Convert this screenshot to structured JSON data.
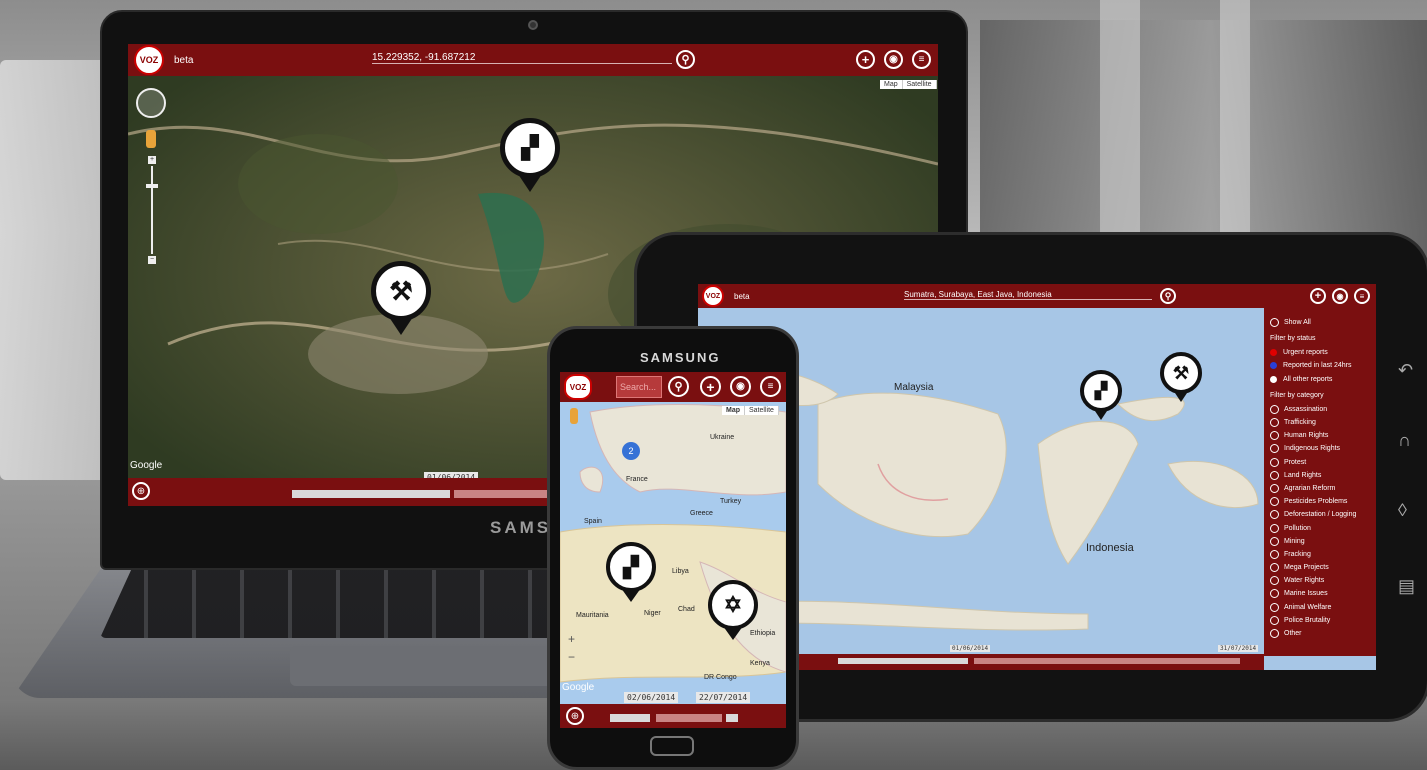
{
  "laptop": {
    "brand": "SAMSUNG",
    "app": {
      "beta_label": "beta",
      "search_value": "15.229352, -91.687212",
      "map_type": [
        "Map",
        "Satellite"
      ],
      "date_start": "01/06/2014",
      "attribution": "Google",
      "pins": [
        {
          "category": "deforestation",
          "icon": "stump-icon"
        },
        {
          "category": "mining",
          "icon": "crossed-hammers-icon"
        }
      ]
    }
  },
  "tablet": {
    "app": {
      "beta_label": "beta",
      "search_value": "Sumatra, Surabaya, East Java, Indonesia",
      "date_start": "01/06/2014",
      "date_end": "31/07/2014",
      "map_labels": [
        "Malaysia",
        "Indonesia"
      ],
      "panel": {
        "show_all": "Show All",
        "filter_status_title": "Filter by status",
        "status": [
          {
            "label": "Urgent reports",
            "color": "#e00000"
          },
          {
            "label": "Reported in last 24hrs",
            "color": "#2a3fd8"
          },
          {
            "label": "All other reports",
            "color": "#ffffff"
          }
        ],
        "filter_category_title": "Filter by category",
        "categories": [
          "Assassination",
          "Trafficking",
          "Human Rights",
          "Indigenous Rights",
          "Protest",
          "Land Rights",
          "Agrarian Reform",
          "Pesticides Problems",
          "Deforestation / Logging",
          "Pollution",
          "Mining",
          "Fracking",
          "Mega Projects",
          "Water Rights",
          "Marine Issues",
          "Animal Welfare",
          "Police Brutality",
          "Other"
        ]
      }
    }
  },
  "phone": {
    "brand": "SAMSUNG",
    "app": {
      "search_placeholder": "Search...",
      "map_type": [
        "Map",
        "Satellite"
      ],
      "cluster_count": "2",
      "date_start": "02/06/2014",
      "date_end": "22/07/2014",
      "attribution": "Google",
      "map_labels": [
        "Libya",
        "Mauritania",
        "Niger",
        "Chad",
        "Ethiopia",
        "Kenya",
        "DR Congo",
        "Ukraine",
        "France",
        "Spain",
        "Greece",
        "Turkey"
      ]
    }
  },
  "colors": {
    "brand_red": "#7a0f10",
    "pin_black": "#111111"
  }
}
